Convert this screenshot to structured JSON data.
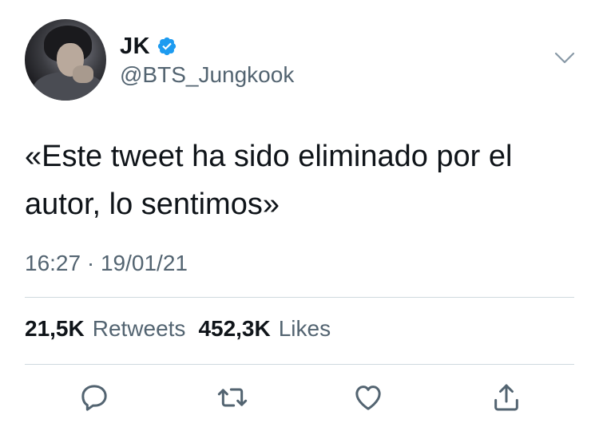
{
  "author": {
    "display_name": "JK",
    "handle": "@BTS_Jungkook",
    "verified": true
  },
  "tweet": {
    "text": "«Este tweet ha sido eliminado por el autor, lo sentimos»",
    "time": "16:27",
    "separator": "·",
    "date": "19/01/21"
  },
  "stats": {
    "retweets_count": "21,5K",
    "retweets_label": "Retweets",
    "likes_count": "452,3K",
    "likes_label": "Likes"
  },
  "icons": {
    "verified": "verified-badge-icon",
    "menu": "chevron-down-icon",
    "reply": "reply-icon",
    "retweet": "retweet-icon",
    "like": "heart-icon",
    "share": "share-icon"
  },
  "colors": {
    "verified_blue": "#1d9bf0",
    "secondary_text": "#536471",
    "primary_text": "#0f1419",
    "divider": "#cfd9de"
  }
}
